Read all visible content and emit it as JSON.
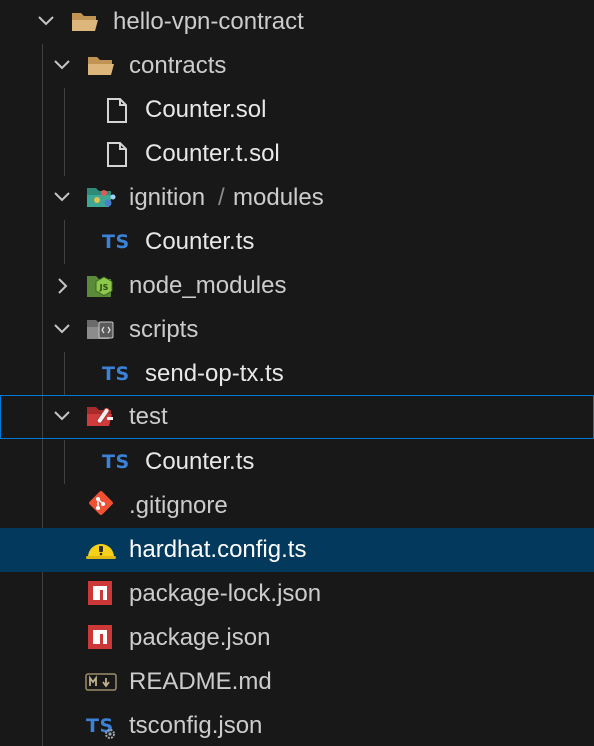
{
  "tree": {
    "root": {
      "label": "hello-vpn-contract",
      "icon": "folder-open-icon",
      "expanded": true
    },
    "contracts": {
      "label": "contracts",
      "icon": "folder-open-icon",
      "expanded": true
    },
    "counter_sol": {
      "label": "Counter.sol",
      "icon": "file-icon"
    },
    "counter_t_sol": {
      "label": "Counter.t.sol",
      "icon": "file-icon"
    },
    "ignition": {
      "label_a": "ignition",
      "separator": "/",
      "label_b": "modules",
      "icon": "folder-ignition-icon",
      "expanded": true
    },
    "ignition_counter": {
      "label": "Counter.ts",
      "icon": "typescript-icon",
      "badge": "TS"
    },
    "node_modules": {
      "label": "node_modules",
      "icon": "folder-node-icon",
      "expanded": false
    },
    "scripts": {
      "label": "scripts",
      "icon": "folder-scripts-icon",
      "expanded": true
    },
    "send_op_tx": {
      "label": "send-op-tx.ts",
      "icon": "typescript-icon",
      "badge": "TS"
    },
    "test": {
      "label": "test",
      "icon": "folder-test-icon",
      "expanded": true,
      "focused": true
    },
    "test_counter": {
      "label": "Counter.ts",
      "icon": "typescript-icon",
      "badge": "TS"
    },
    "gitignore": {
      "label": ".gitignore",
      "icon": "git-icon"
    },
    "hardhat_config": {
      "label": "hardhat.config.ts",
      "icon": "hardhat-icon",
      "selected": true
    },
    "package_lock": {
      "label": "package-lock.json",
      "icon": "npm-icon"
    },
    "package_json": {
      "label": "package.json",
      "icon": "npm-icon"
    },
    "readme": {
      "label": "README.md",
      "icon": "markdown-icon"
    },
    "tsconfig": {
      "label": "tsconfig.json",
      "icon": "tsconfig-icon",
      "badge": "TS"
    }
  },
  "colors": {
    "background": "#181818",
    "selection": "#04395e",
    "focus_border": "#0078d4",
    "text": "#cccccc",
    "ts_blue": "#3c82d6",
    "npm_red": "#cb3837",
    "git_orange": "#f05133",
    "hardhat_yellow": "#f7d117"
  }
}
